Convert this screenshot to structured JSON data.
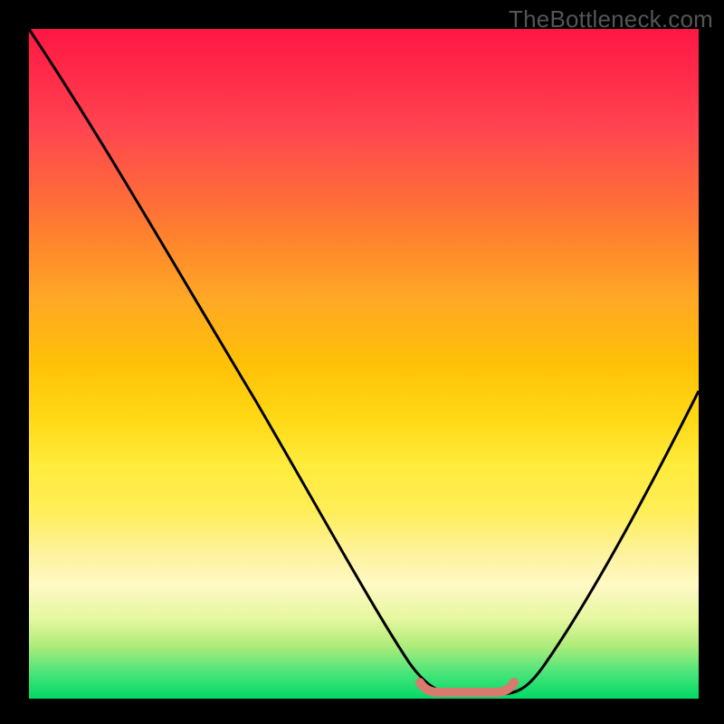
{
  "watermark": "TheBottleneck.com",
  "chart_data": {
    "type": "line",
    "title": "",
    "xlabel": "",
    "ylabel": "",
    "xlim": [
      0,
      100
    ],
    "ylim": [
      0,
      100
    ],
    "x": [
      0,
      5,
      10,
      15,
      20,
      25,
      30,
      35,
      40,
      45,
      50,
      55,
      58,
      62,
      66,
      70,
      72,
      75,
      80,
      85,
      90,
      95,
      100
    ],
    "values": [
      100,
      93,
      86,
      78,
      71,
      63,
      55,
      47,
      40,
      32,
      24,
      14,
      6,
      2,
      1,
      1,
      2,
      6,
      14,
      23,
      32,
      42,
      52
    ],
    "series": [
      {
        "name": "bottleneck-curve",
        "color": "#000000"
      },
      {
        "name": "optimal-band",
        "color": "#d97a6e",
        "x": [
          58,
          72
        ],
        "values": [
          2,
          2
        ]
      }
    ],
    "background_gradient": {
      "top": "#ff1744",
      "mid": "#ffeb3b",
      "bottom": "#00d966"
    }
  }
}
